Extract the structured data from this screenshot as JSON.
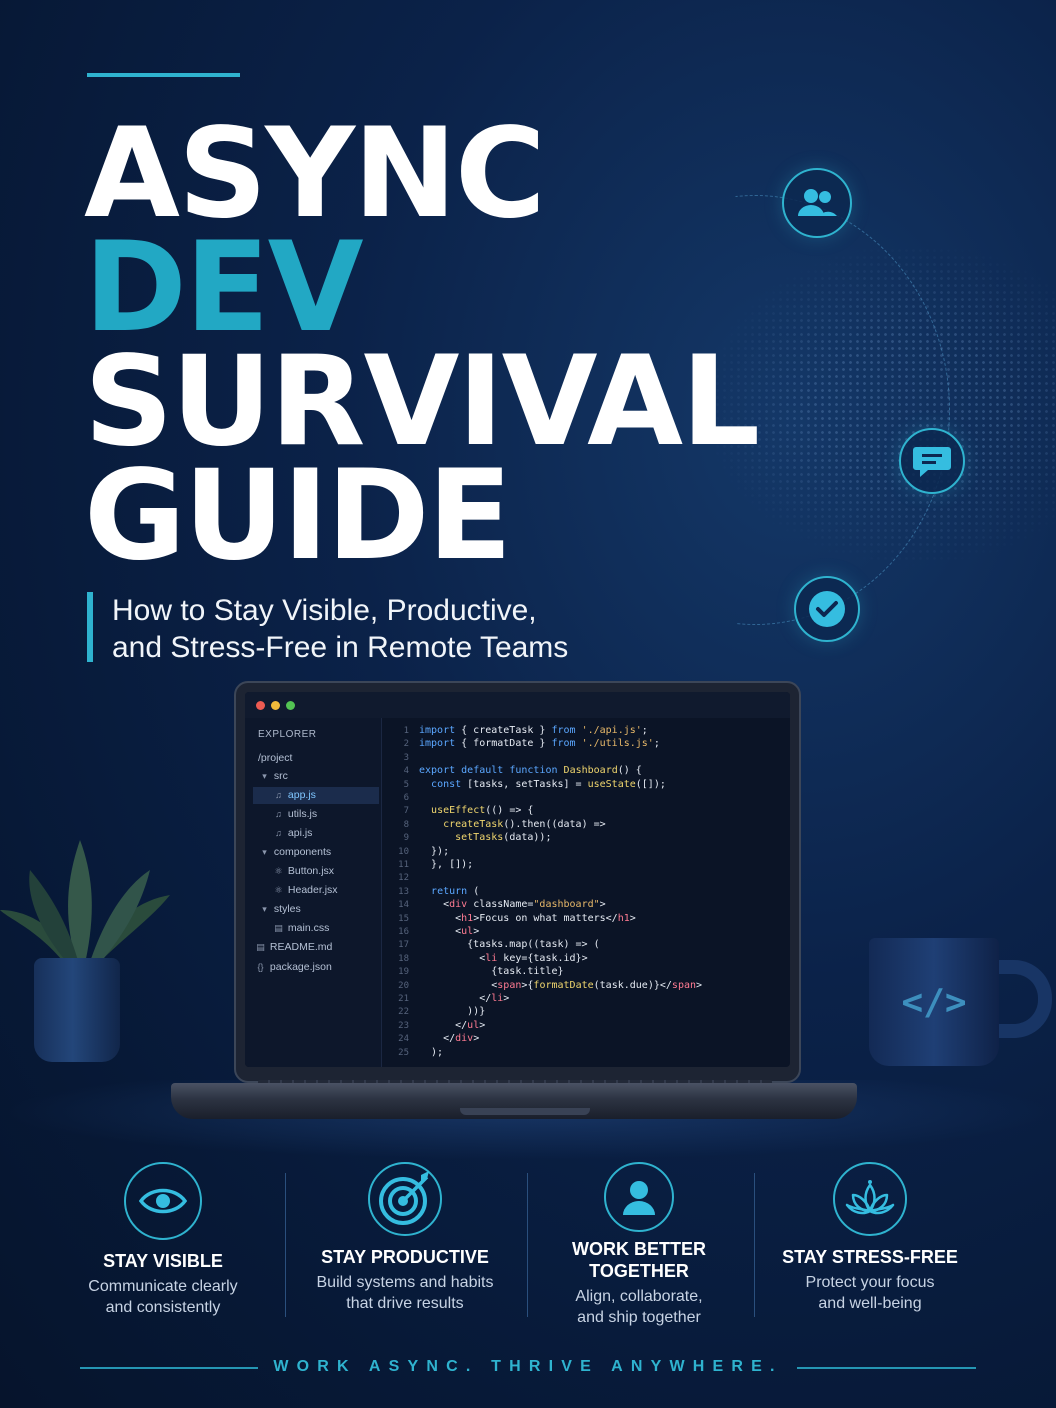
{
  "title": {
    "line1": "ASYNC",
    "line2": "DEV",
    "line3": "SURVIVAL",
    "line4": "GUIDE"
  },
  "subtitle": {
    "line1": "How to Stay Visible, Productive,",
    "line2": "and Stress-Free in Remote Teams"
  },
  "colors": {
    "accent": "#2fb3cf",
    "accent_title": "#22a8c4",
    "background": "#0b2249"
  },
  "floating_icons": [
    "users-icon",
    "chat-icon",
    "check-icon"
  ],
  "editor": {
    "explorer_title": "EXPLORER",
    "project": "/project",
    "tree": [
      {
        "label": "src",
        "icon": "chevron-down-icon"
      },
      {
        "label": "app.js",
        "icon": "js-file-icon",
        "active": true
      },
      {
        "label": "utils.js",
        "icon": "js-file-icon"
      },
      {
        "label": "api.js",
        "icon": "js-file-icon"
      },
      {
        "label": "components",
        "icon": "chevron-down-icon"
      },
      {
        "label": "Button.jsx",
        "icon": "react-file-icon"
      },
      {
        "label": "Header.jsx",
        "icon": "react-file-icon"
      },
      {
        "label": "styles",
        "icon": "chevron-down-icon"
      },
      {
        "label": "main.css",
        "icon": "css-file-icon"
      },
      {
        "label": "README.md",
        "icon": "md-file-icon"
      },
      {
        "label": "package.json",
        "icon": "json-file-icon"
      }
    ],
    "code": [
      {
        "n": "1",
        "t": "import { createTask } from './api.js';"
      },
      {
        "n": "2",
        "t": "import { formatDate } from './utils.js';"
      },
      {
        "n": "3",
        "t": ""
      },
      {
        "n": "4",
        "t": "export default function Dashboard() {"
      },
      {
        "n": "5",
        "t": "  const [tasks, setTasks] = useState([]);"
      },
      {
        "n": "6",
        "t": ""
      },
      {
        "n": "7",
        "t": "  useEffect(() => {"
      },
      {
        "n": "8",
        "t": "    createTask().then((data) =>"
      },
      {
        "n": "9",
        "t": "      setTasks(data));"
      },
      {
        "n": "10",
        "t": "  });"
      },
      {
        "n": "11",
        "t": "  }, []);"
      },
      {
        "n": "12",
        "t": ""
      },
      {
        "n": "13",
        "t": "  return ("
      },
      {
        "n": "14",
        "t": "    <div className=\"dashboard\">"
      },
      {
        "n": "15",
        "t": "      <h1>Focus on what matters</h1>"
      },
      {
        "n": "16",
        "t": "      <ul>"
      },
      {
        "n": "17",
        "t": "        {tasks.map((task) => ("
      },
      {
        "n": "18",
        "t": "          <li key={task.id}>"
      },
      {
        "n": "19",
        "t": "            {task.title}"
      },
      {
        "n": "20",
        "t": "            <span>{formatDate(task.due)}</span>"
      },
      {
        "n": "21",
        "t": "          </li>"
      },
      {
        "n": "22",
        "t": "        ))}"
      },
      {
        "n": "23",
        "t": "      </ul>"
      },
      {
        "n": "24",
        "t": "    </div>"
      },
      {
        "n": "25",
        "t": "  );"
      }
    ]
  },
  "mug_label": "</>",
  "features": [
    {
      "icon": "eye-icon",
      "title": "STAY VISIBLE",
      "desc1": "Communicate clearly",
      "desc2": "and consistently"
    },
    {
      "icon": "target-icon",
      "title": "STAY PRODUCTIVE",
      "desc1": "Build systems and habits",
      "desc2": "that drive results"
    },
    {
      "icon": "person-icon",
      "title": "WORK BETTER TOGETHER",
      "desc1": "Align, collaborate,",
      "desc2": "and ship together"
    },
    {
      "icon": "lotus-icon",
      "title": "STAY STRESS-FREE",
      "desc1": "Protect your focus",
      "desc2": "and well-being"
    }
  ],
  "tagline": "WORK ASYNC.  THRIVE ANYWHERE."
}
